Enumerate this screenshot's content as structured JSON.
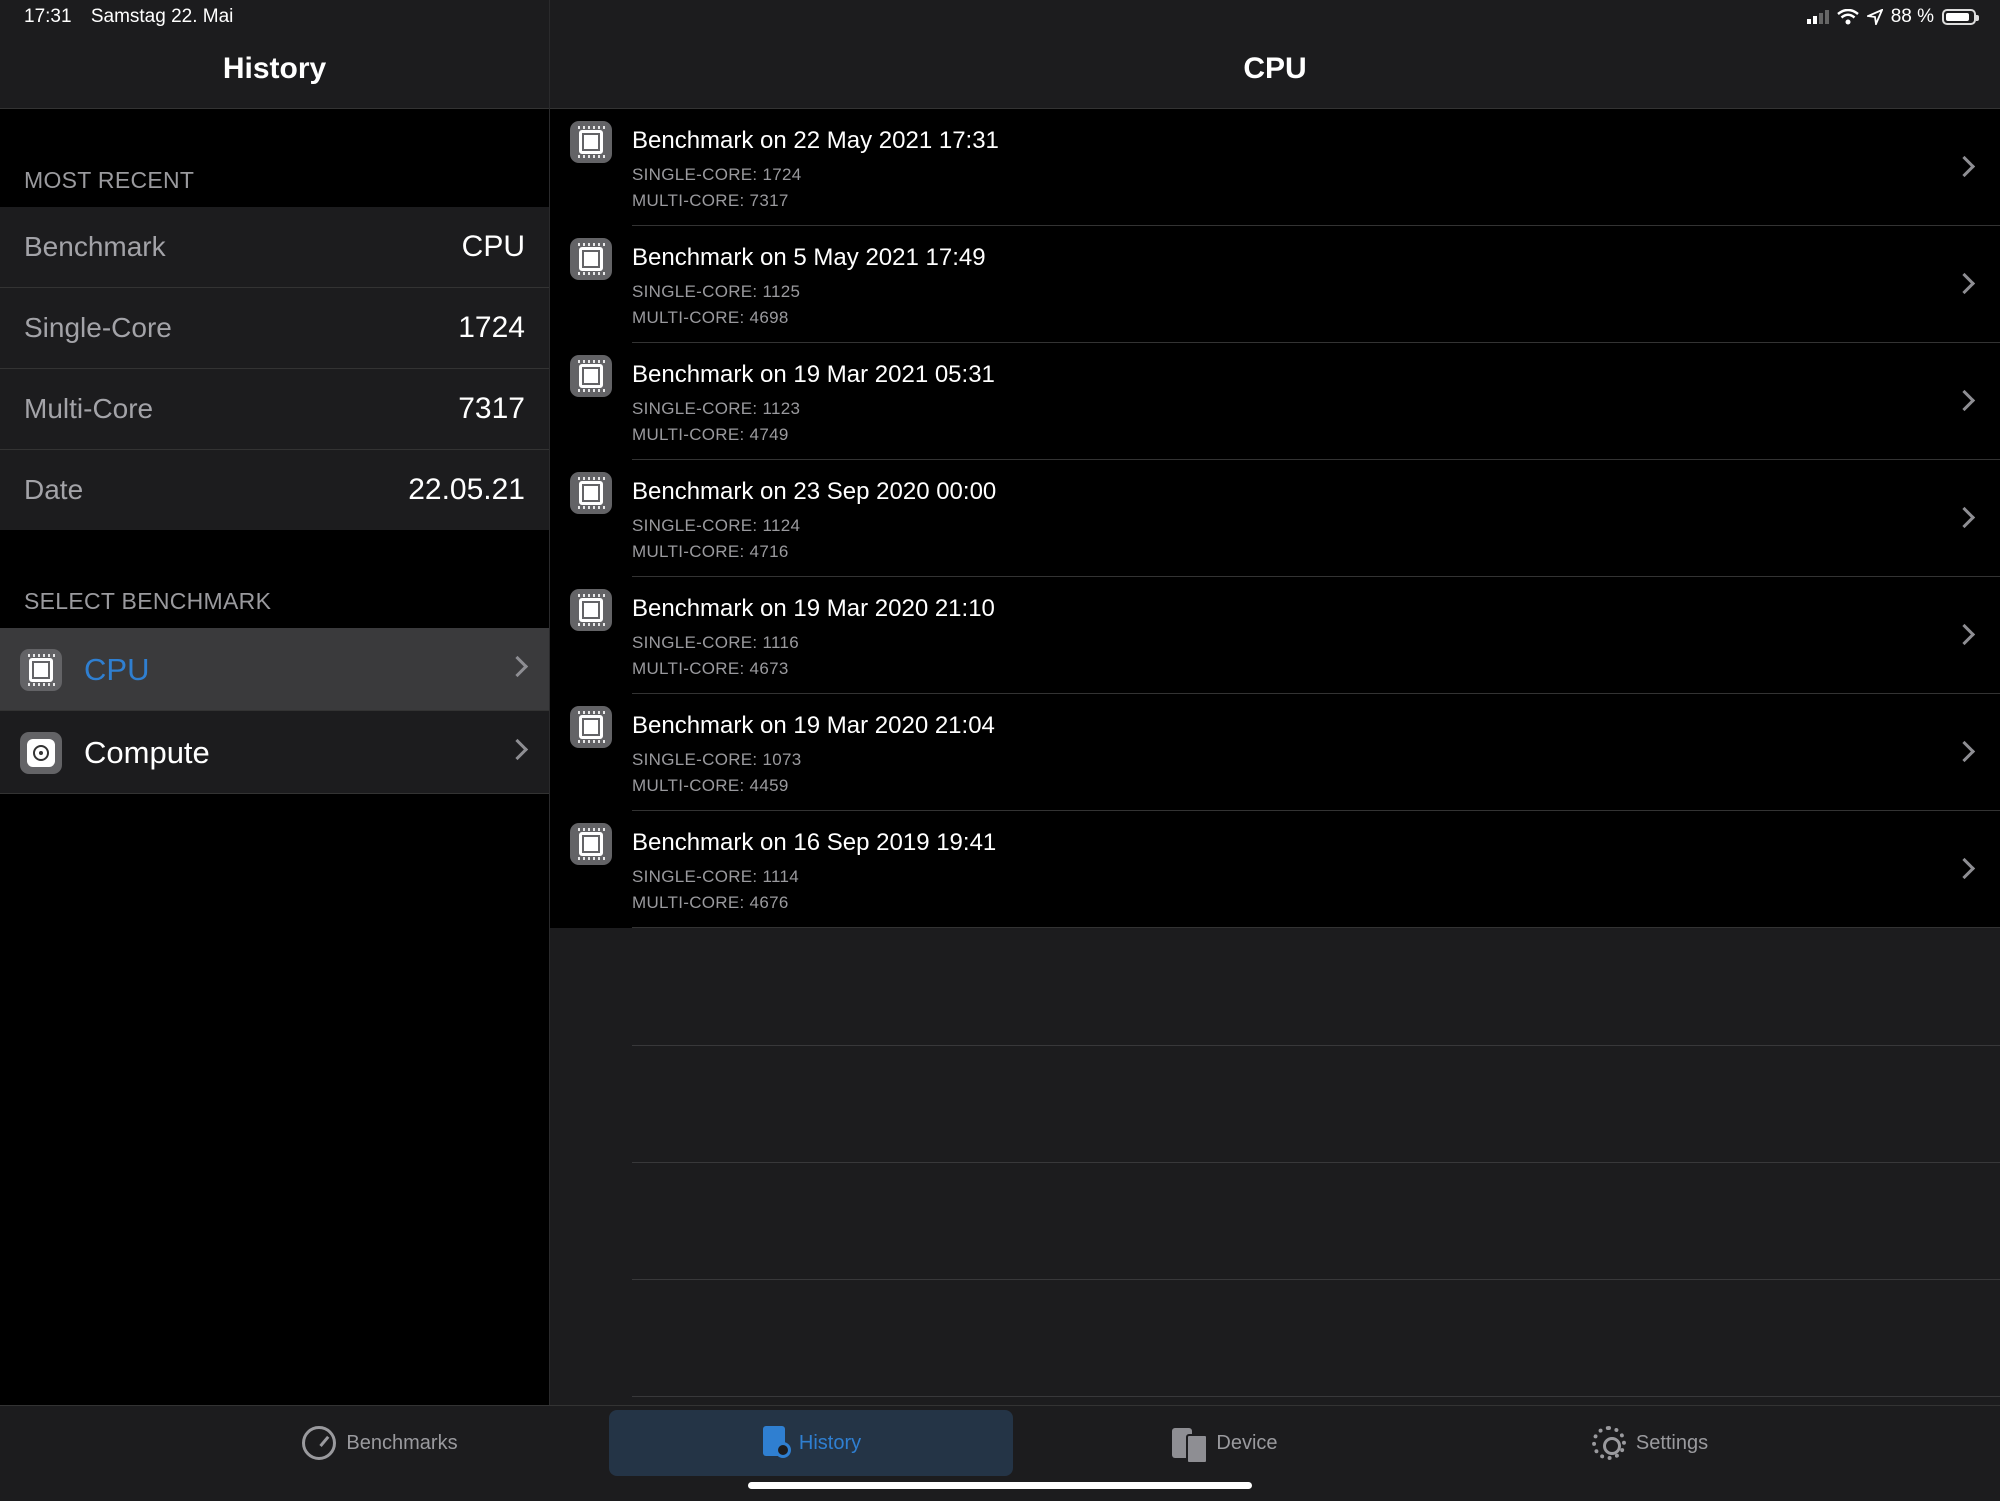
{
  "status_bar": {
    "time": "17:31",
    "date": "Samstag 22. Mai",
    "battery": "88 %",
    "battery_level": 0.88
  },
  "sidebar": {
    "title": "History",
    "most_recent_label": "MOST RECENT",
    "rows": [
      {
        "label": "Benchmark",
        "value": "CPU"
      },
      {
        "label": "Single-Core",
        "value": "1724"
      },
      {
        "label": "Multi-Core",
        "value": "7317"
      },
      {
        "label": "Date",
        "value": "22.05.21"
      }
    ],
    "select_label": "SELECT BENCHMARK",
    "benchmarks": [
      {
        "label": "CPU",
        "icon": "cpu-chip-icon",
        "selected": true
      },
      {
        "label": "Compute",
        "icon": "compute-icon",
        "selected": false
      }
    ]
  },
  "main": {
    "title": "CPU",
    "history": [
      {
        "title": "Benchmark on 22 May 2021 17:31",
        "single": "SINGLE-CORE: 1724",
        "multi": "MULTI-CORE: 7317"
      },
      {
        "title": "Benchmark on 5 May 2021 17:49",
        "single": "SINGLE-CORE: 1125",
        "multi": "MULTI-CORE: 4698"
      },
      {
        "title": "Benchmark on 19 Mar 2021 05:31",
        "single": "SINGLE-CORE: 1123",
        "multi": "MULTI-CORE: 4749"
      },
      {
        "title": "Benchmark on 23 Sep 2020 00:00",
        "single": "SINGLE-CORE: 1124",
        "multi": "MULTI-CORE: 4716"
      },
      {
        "title": "Benchmark on 19 Mar 2020 21:10",
        "single": "SINGLE-CORE: 1116",
        "multi": "MULTI-CORE: 4673"
      },
      {
        "title": "Benchmark on 19 Mar 2020 21:04",
        "single": "SINGLE-CORE: 1073",
        "multi": "MULTI-CORE: 4459"
      },
      {
        "title": "Benchmark on 16 Sep 2019 19:41",
        "single": "SINGLE-CORE: 1114",
        "multi": "MULTI-CORE: 4676"
      }
    ]
  },
  "tab_bar": {
    "tabs": [
      {
        "label": "Benchmarks",
        "icon": "gauge-icon",
        "active": false
      },
      {
        "label": "History",
        "icon": "history-document-icon",
        "active": true
      },
      {
        "label": "Device",
        "icon": "device-icon",
        "active": false
      },
      {
        "label": "Settings",
        "icon": "gear-icon",
        "active": false
      }
    ]
  },
  "colors": {
    "accent": "#2f7fd1",
    "background": "#000000",
    "panel": "#1c1c1e",
    "selected_row": "#3a3a3c"
  }
}
